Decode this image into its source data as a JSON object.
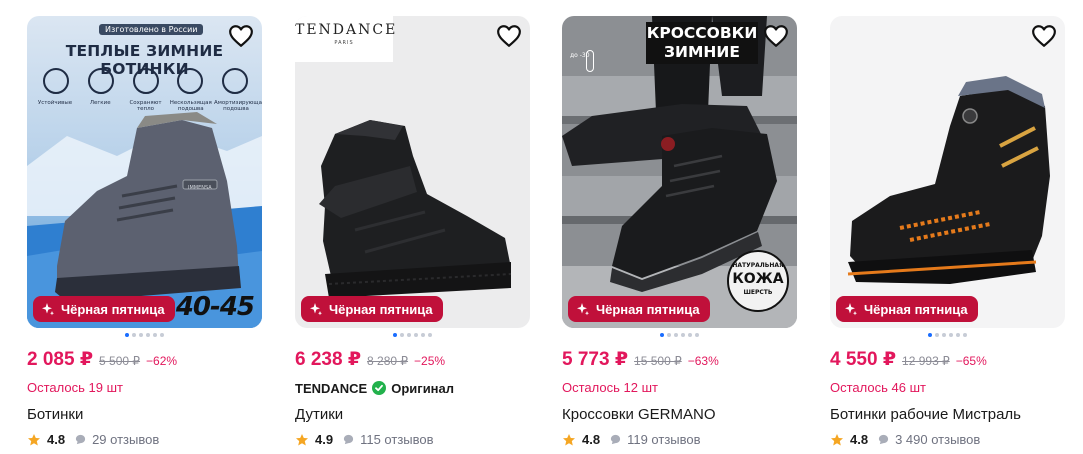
{
  "colors": {
    "accent": "#e2175c",
    "promo_bg": "#c0103a",
    "dot_active": "#1a6dff",
    "star": "#f5a623",
    "original": "#22b14c"
  },
  "products": [
    {
      "promo": "Чёрная пятница",
      "price": "2 085 ₽",
      "old_price": "5 500 ₽",
      "discount": "−62%",
      "stock": "Осталось 19 шт",
      "title": "Ботинки",
      "rating": "4.8",
      "reviews": "29 отзывов",
      "image_text": {
        "made": "Изготовлено в России",
        "headline": "ТЕПЛЫЕ ЗИМНИЕ БОТИНКИ",
        "f1": "Устойчивые",
        "f2": "Легкие",
        "f3": "Сохраняют тепло",
        "f4": "Нескользящая подошва",
        "f5": "Амортизирующая подошва",
        "sizes": "40-45",
        "logo": "IMMENSA"
      }
    },
    {
      "promo": "Чёрная пятница",
      "price": "6 238 ₽",
      "old_price": "8 280 ₽",
      "discount": "−25%",
      "brand": "TENDANCE",
      "original": "Оригинал",
      "title": "Дутики",
      "rating": "4.9",
      "reviews": "115 отзывов",
      "image_text": {
        "logo": "TENDANCE",
        "logo_sub": "PARIS"
      }
    },
    {
      "promo": "Чёрная пятница",
      "price": "5 773 ₽",
      "old_price": "15 500 ₽",
      "discount": "−63%",
      "stock": "Осталось 12 шт",
      "title": "Кроссовки GERMANO",
      "rating": "4.8",
      "reviews": "119 отзывов",
      "image_text": {
        "line1": "КРОССОВКИ",
        "line2": "ЗИМНИЕ",
        "temp": "до -30",
        "leather_top": "НАТУРАЛЬНАЯ",
        "leather_mid": "КОЖА",
        "leather_bot": "ШЕРСТЬ"
      }
    },
    {
      "promo": "Чёрная пятница",
      "price": "4 550 ₽",
      "old_price": "12 993 ₽",
      "discount": "−65%",
      "stock": "Осталось 46 шт",
      "title": "Ботинки рабочие Мистраль",
      "rating": "4.8",
      "reviews": "3 490 отзывов"
    }
  ]
}
